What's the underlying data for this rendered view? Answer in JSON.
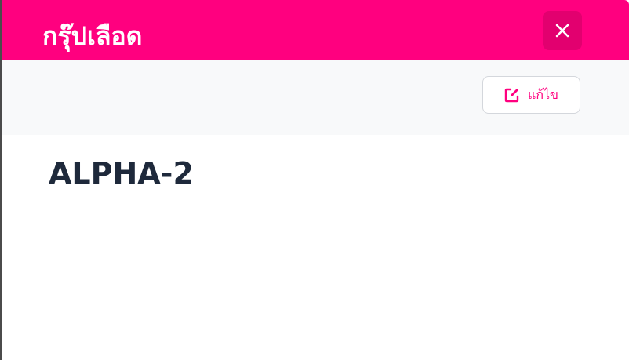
{
  "header": {
    "title": "กรุ๊ปเลือด",
    "close_icon": "close-icon",
    "bg_color": "#ff007f"
  },
  "toolbar": {
    "edit_label": "แก้ไข",
    "edit_icon": "edit-icon",
    "accent_color": "#ff007f"
  },
  "content": {
    "title": "ALPHA-2"
  }
}
